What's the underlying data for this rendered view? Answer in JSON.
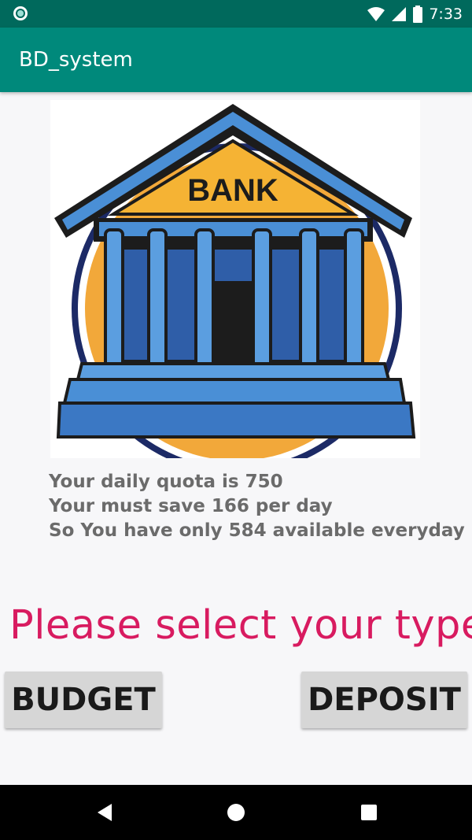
{
  "status_bar": {
    "time": "7:33",
    "icons": [
      "app-notification-icon",
      "wifi-icon",
      "cell-signal-icon",
      "battery-icon"
    ]
  },
  "app_bar": {
    "title": "BD_system",
    "color": "#00897b"
  },
  "image": {
    "label": "BANK",
    "icon": "bank-building-icon"
  },
  "info": {
    "line1": "Your daily quota is 750",
    "line2": "Your must save 166 per day",
    "line3": "So You have only 584 available everyday"
  },
  "prompt": {
    "text": "Please select your type",
    "color": "#d81b60"
  },
  "buttons": {
    "budget": "BUDGET",
    "deposit": "DEPOSIT"
  },
  "nav_bar": {
    "icons": [
      "back-icon",
      "home-icon",
      "recents-icon"
    ]
  }
}
